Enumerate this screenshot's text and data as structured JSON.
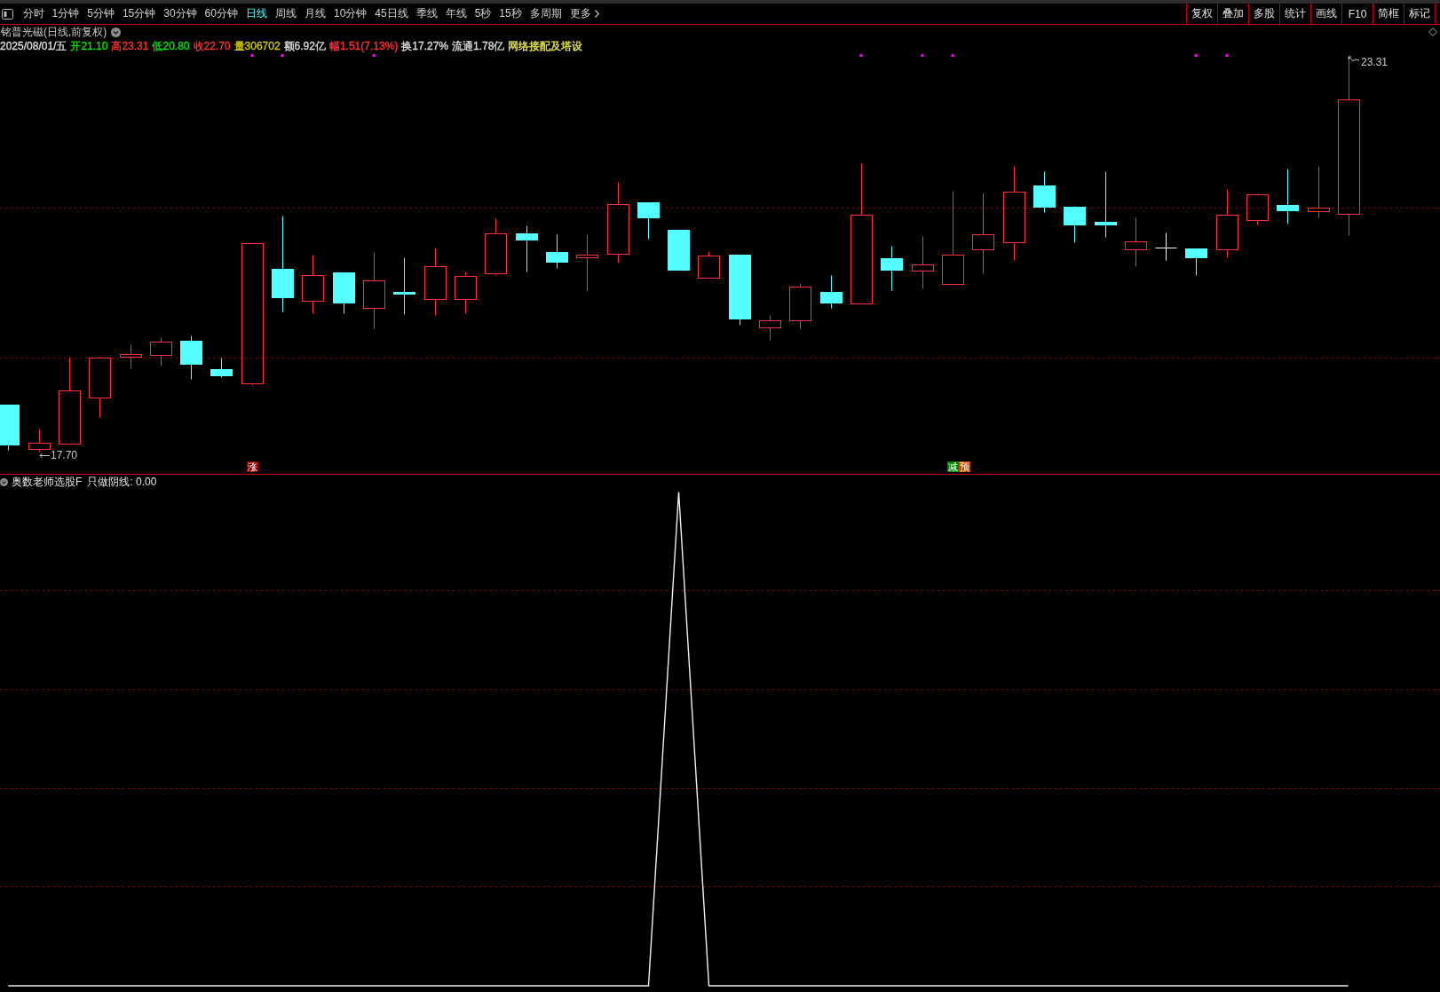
{
  "toolbar": {
    "period_tabs": [
      {
        "label": "分时",
        "selected": false
      },
      {
        "label": "1分钟",
        "selected": false
      },
      {
        "label": "5分钟",
        "selected": false
      },
      {
        "label": "15分钟",
        "selected": false
      },
      {
        "label": "30分钟",
        "selected": false
      },
      {
        "label": "60分钟",
        "selected": false
      },
      {
        "label": "日线",
        "selected": true
      },
      {
        "label": "周线",
        "selected": false
      },
      {
        "label": "月线",
        "selected": false
      },
      {
        "label": "10分钟",
        "selected": false
      },
      {
        "label": "45日线",
        "selected": false
      },
      {
        "label": "季线",
        "selected": false
      },
      {
        "label": "年线",
        "selected": false
      },
      {
        "label": "5秒",
        "selected": false
      },
      {
        "label": "15秒",
        "selected": false
      },
      {
        "label": "多周期",
        "selected": false
      }
    ],
    "more": {
      "label": "更多"
    },
    "actions": [
      "复权",
      "叠加",
      "多股",
      "统计",
      "画线",
      "F10",
      "简框",
      "标记"
    ]
  },
  "chart_title": "铭普光磁(日线,前复权)",
  "quote_line": [
    {
      "text": "2025/08/01/五",
      "color": "#dcdcdc"
    },
    {
      "text": "开21.10",
      "color": "#00e600"
    },
    {
      "text": "高23.31",
      "color": "#ff3232"
    },
    {
      "text": "低20.80",
      "color": "#00e600"
    },
    {
      "text": "收22.70",
      "color": "#ff3232"
    },
    {
      "text": "量306702",
      "color": "#d2c800"
    },
    {
      "text": "额6.92亿",
      "color": "#dcdcdc"
    },
    {
      "text": "幅1.51(7.13%)",
      "color": "#ff3232"
    },
    {
      "text": "换17.27%",
      "color": "#dcdcdc"
    },
    {
      "text": "流通1.78亿",
      "color": "#dcdcdc"
    },
    {
      "text": "网络接配及塔设",
      "color": "#e6e650"
    }
  ],
  "main_chart": {
    "low_label": "17.70",
    "high_label": "23.31",
    "signals": [
      {
        "labels": [
          {
            "text": "涨",
            "color": "#900000"
          }
        ]
      },
      {
        "labels": [
          {
            "text": "减",
            "color": "#008000"
          },
          {
            "text": "预",
            "color": "#c84800"
          }
        ]
      }
    ]
  },
  "indicator": {
    "name": "奥数老师选股F",
    "reading": "只做阴线: 0.00"
  }
}
